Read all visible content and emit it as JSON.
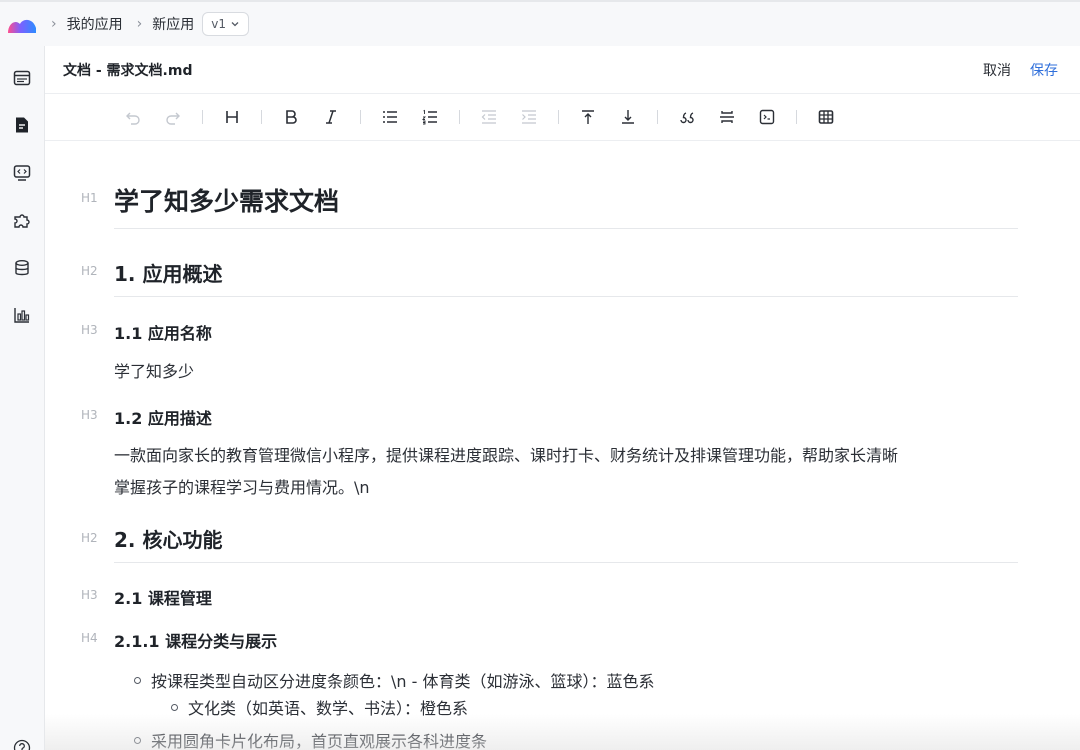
{
  "breadcrumb": {
    "items": [
      "我的应用",
      "新应用"
    ],
    "version": "v1"
  },
  "sidebar": {
    "items": [
      {
        "name": "browser-icon"
      },
      {
        "name": "document-icon"
      },
      {
        "name": "code-icon"
      },
      {
        "name": "plugin-icon"
      },
      {
        "name": "database-icon"
      },
      {
        "name": "chart-icon"
      }
    ],
    "help_icon": "help-icon"
  },
  "document": {
    "title": "文档 - 需求文档.md",
    "cancel": "取消",
    "save": "保存"
  },
  "toolbar": {
    "tools": [
      "undo",
      "redo",
      "heading",
      "bold",
      "italic",
      "bullet-list",
      "ordered-list",
      "outdent",
      "indent",
      "align-top",
      "align-bottom",
      "blockquote",
      "divider",
      "code-block",
      "table"
    ]
  },
  "content": {
    "h1": {
      "tag": "H1",
      "text": "学了知多少需求文档"
    },
    "s1": {
      "tag": "H2",
      "text": "1. 应用概述"
    },
    "s1_1": {
      "tag": "H3",
      "text": "1.1 应用名称"
    },
    "s1_1_p": "学了知多少",
    "s1_2": {
      "tag": "H3",
      "text": "1.2 应用描述"
    },
    "s1_2_p1": "一款面向家长的教育管理微信小程序，提供课程进度跟踪、课时打卡、财务统计及排课管理功能，帮助家长清晰",
    "s1_2_p2": "掌握孩子的课程学习与费用情况。\\n",
    "s2": {
      "tag": "H2",
      "text": "2. 核心功能"
    },
    "s2_1": {
      "tag": "H3",
      "text": "2.1 课程管理"
    },
    "s2_1_1": {
      "tag": "H4",
      "text": "2.1.1 课程分类与展示"
    },
    "list": [
      "按课程类型自动区分进度条颜色：\\n  - 体育类（如游泳、篮球）：蓝色系",
      "文化类（如英语、数学、书法）：橙色系",
      "采用圆角卡片化布局，首页直观展示各科进度条"
    ]
  }
}
